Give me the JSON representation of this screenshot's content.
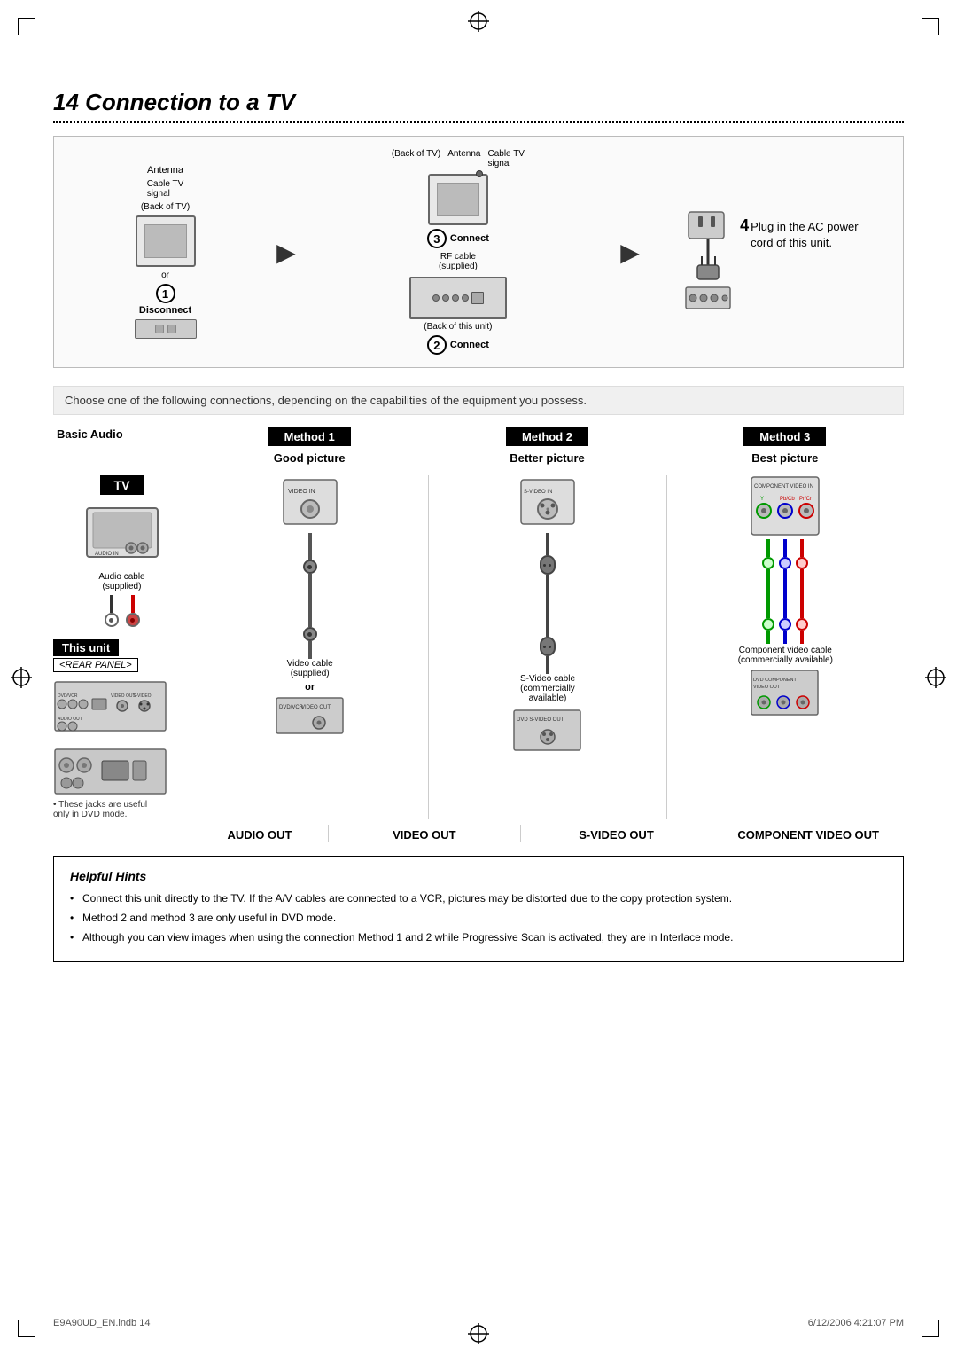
{
  "page": {
    "title": "14  Connection to a TV",
    "footer_left": "E9A90UD_EN.indb  14",
    "footer_right": "6/12/2006  4:21:07 PM"
  },
  "top_diagram": {
    "step1": {
      "label_tv": "Antenna",
      "label_tv2": "Cable TV\nsignal",
      "label_back": "(Back of TV)",
      "step_num": "1",
      "action": "Disconnect"
    },
    "step3": {
      "label_tv": "(Back of TV)",
      "label_ant": "Antenna",
      "label_cable": "Cable TV\nsignal",
      "step_num": "3",
      "action": "Connect",
      "cable": "RF cable\n(supplied)",
      "back_label": "(Back of this unit)"
    },
    "step4": {
      "step_num": "4",
      "text": "Plug in the AC power\ncord of this unit."
    },
    "step2": {
      "step_num": "2",
      "action": "Connect"
    }
  },
  "choose_text": "Choose one of the following connections, depending on the capabilities of the equipment you possess.",
  "methods": {
    "left": {
      "basic_audio": "Basic Audio",
      "tv_label": "TV",
      "this_unit": "This unit",
      "rear_panel": "<REAR PANEL>",
      "audio_cable": "Audio cable\n(supplied)",
      "star_note": "• These jacks are useful\n  only in DVD mode."
    },
    "method1": {
      "header": "Method 1",
      "quality": "Good picture",
      "cable": "Video cable\n(supplied)",
      "out_label": "VIDEO OUT"
    },
    "method2": {
      "header": "Method 2",
      "quality": "Better picture",
      "cable": "S-Video cable\n(commercially\navailable)",
      "out_label": "S-VIDEO OUT"
    },
    "method3": {
      "header": "Method 3",
      "quality": "Best picture",
      "cable": "Component video cable\n(commercially available)",
      "out_label": "COMPONENT VIDEO OUT"
    },
    "audio_out_label": "AUDIO OUT"
  },
  "hints": {
    "title": "Helpful Hints",
    "items": [
      "Connect this unit directly to the TV. If the A/V cables are connected to a VCR, pictures may be distorted due to the copy protection system.",
      "Method 2 and method 3 are only useful in DVD mode.",
      "Although you can view images when using the connection Method 1 and 2 while Progressive Scan is activated, they are in Interlace mode."
    ]
  }
}
